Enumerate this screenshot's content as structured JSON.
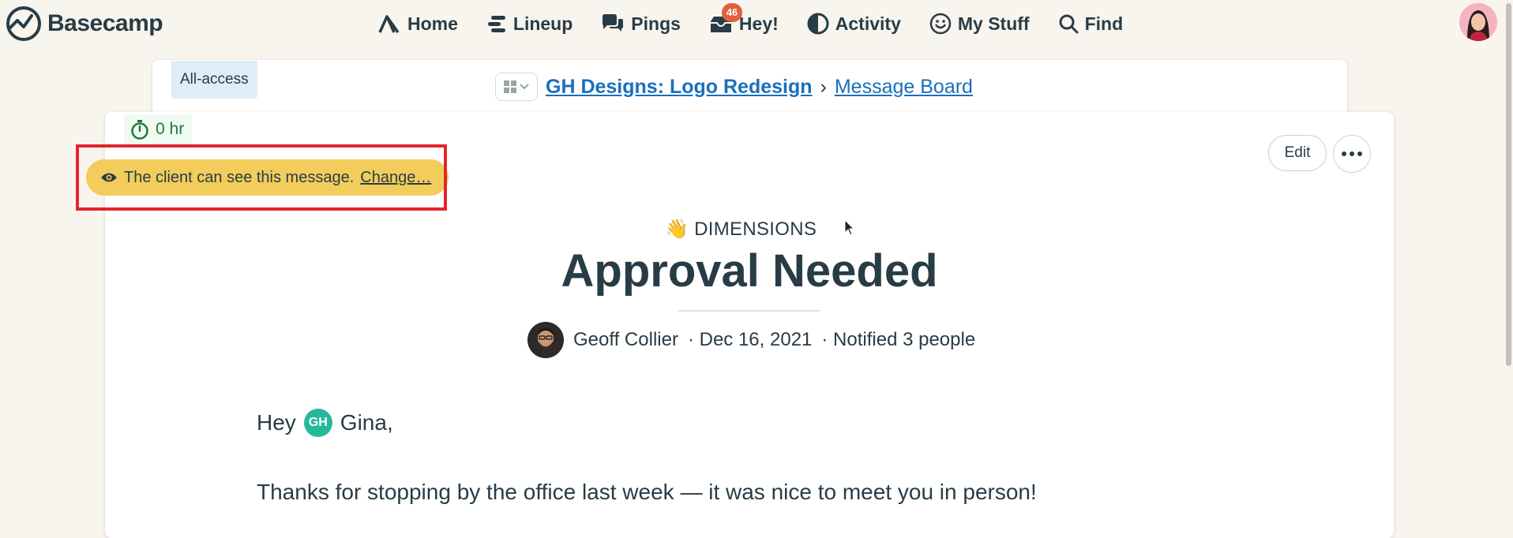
{
  "app": {
    "logo_text": "Basecamp"
  },
  "nav": {
    "items": [
      {
        "label": "Home",
        "icon": "home-icon"
      },
      {
        "label": "Lineup",
        "icon": "lineup-icon"
      },
      {
        "label": "Pings",
        "icon": "pings-icon"
      },
      {
        "label": "Hey!",
        "icon": "hey-inbox-icon",
        "badge": "46"
      },
      {
        "label": "Activity",
        "icon": "activity-icon"
      },
      {
        "label": "My Stuff",
        "icon": "smiley-icon"
      },
      {
        "label": "Find",
        "icon": "search-icon"
      }
    ]
  },
  "project": {
    "access_label": "All-access",
    "name": "GH Designs: Logo Redesign",
    "separator": "›",
    "section": "Message Board"
  },
  "message": {
    "timer": "0 hr",
    "visibility_text": "The client can see this message.",
    "visibility_change": "Change…",
    "edit_label": "Edit",
    "category": "👋 DIMENSIONS",
    "title": "Approval Needed",
    "author": "Geoff Collier",
    "date": "· Dec 16, 2021",
    "notified": "· Notified 3 people",
    "greeting_prefix": "Hey",
    "mention_initials": "GH",
    "mention_name": "Gina,",
    "paragraph_1": "Thanks for stopping by the office last week — it was nice to meet you in person!"
  },
  "colors": {
    "background": "#f8f4ee",
    "link": "#1a6fbd",
    "banner": "#f3cd5b",
    "badge": "#e25f3c",
    "highlight": "#e3252b",
    "mention": "#27b89c"
  }
}
